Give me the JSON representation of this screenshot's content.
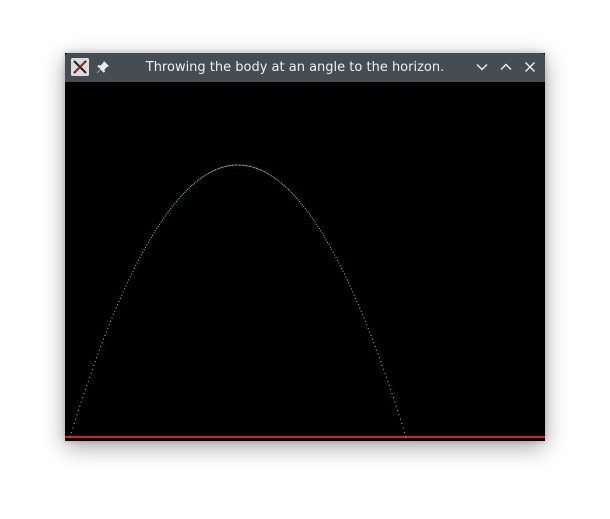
{
  "window": {
    "title": "Throwing the body at an angle to the horizon."
  },
  "titlebar": {
    "app_icon": "x-window-icon",
    "pin_icon": "pin-icon",
    "minimize_icon": "chevron-down-icon",
    "maximize_icon": "chevron-up-icon",
    "close_icon": "close-icon"
  },
  "colors": {
    "titlebar_bg": "#454c52",
    "canvas_bg": "#000000",
    "trajectory": "#b6f26a",
    "ground": "#e01b1b"
  },
  "chart_data": {
    "type": "line",
    "title": "",
    "xlabel": "",
    "ylabel": "",
    "series": [
      {
        "x": [
          0,
          168,
          336
        ],
        "y": [
          0,
          272,
          0
        ]
      }
    ],
    "grid": false,
    "legend": "none"
  }
}
